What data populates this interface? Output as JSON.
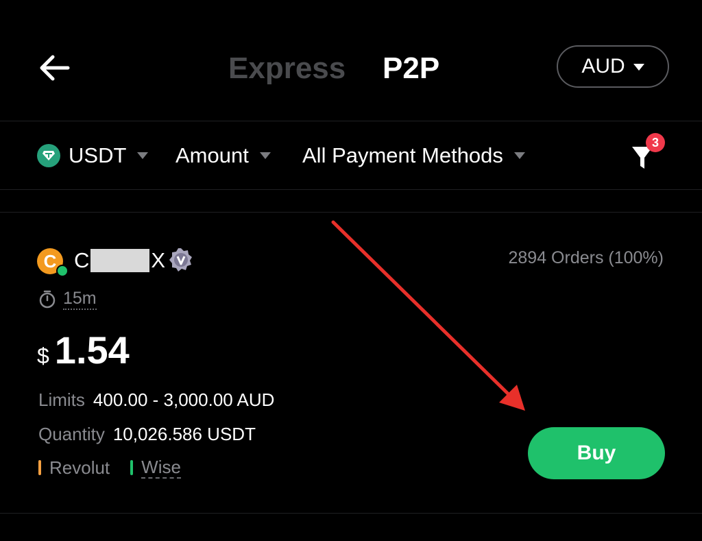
{
  "header": {
    "tabs": [
      {
        "label": "Express",
        "active": false
      },
      {
        "label": "P2P",
        "active": true
      }
    ],
    "currency": "AUD"
  },
  "filters": {
    "coin": "USDT",
    "amount": "Amount",
    "payment_methods": "All Payment Methods",
    "filter_badge_count": "3"
  },
  "listing": {
    "avatar_letter": "C",
    "merchant_name_start": "C",
    "merchant_name_end": "X",
    "orders": "2894 Orders (100%)",
    "payment_time": "15m",
    "price_currency_symbol": "$",
    "price": "1.54",
    "limits_label": "Limits",
    "limits_value": "400.00 - 3,000.00 AUD",
    "quantity_label": "Quantity",
    "quantity_value": "10,026.586 USDT",
    "payment_methods": [
      {
        "name": "Revolut",
        "color": "#f5a041"
      },
      {
        "name": "Wise",
        "color": "#1fc16b"
      }
    ],
    "action_label": "Buy"
  },
  "colors": {
    "background": "#000000",
    "accent_green": "#1fc16b",
    "badge_red": "#f0394b",
    "annotation_arrow": "#e8302a"
  }
}
